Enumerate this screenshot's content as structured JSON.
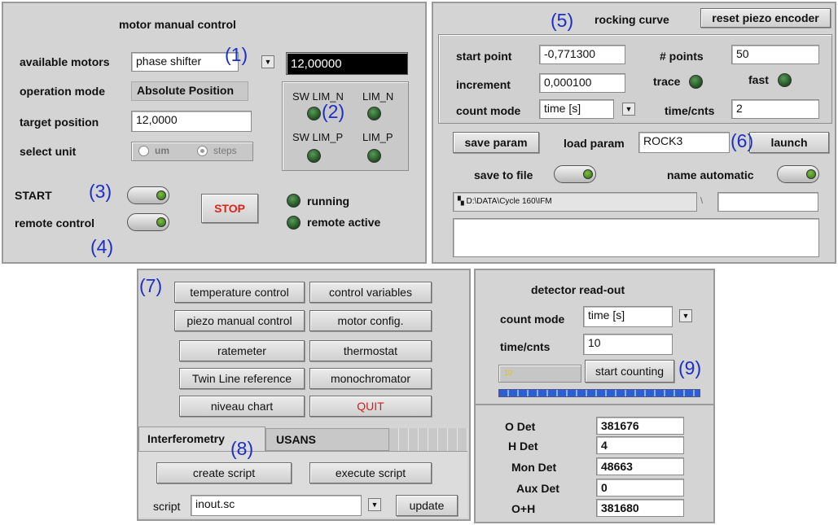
{
  "motor": {
    "title": "motor manual control",
    "available_motors_label": "available motors",
    "available_motors_value": "phase shifter",
    "operation_mode_label": "operation mode",
    "operation_mode_value": "Absolute Position",
    "target_position_label": "target position",
    "target_position_value": "12,0000",
    "select_unit_label": "select unit",
    "unit_um": "um",
    "unit_steps": "steps",
    "display_value": "12,00000",
    "sw_lim_n": "SW LIM_N",
    "lim_n": "LIM_N",
    "sw_lim_p": "SW LIM_P",
    "lim_p": "LIM_P",
    "start_label": "START",
    "remote_label": "remote control",
    "stop_label": "STOP",
    "running_label": "running",
    "remote_active_label": "remote active"
  },
  "rocking": {
    "title": "rocking curve",
    "reset_label": "reset piezo encoder",
    "start_point_label": "start point",
    "start_point_value": "-0,771300",
    "points_label": "# points",
    "points_value": "50",
    "increment_label": "increment",
    "increment_value": "0,000100",
    "trace_label": "trace",
    "fast_label": "fast",
    "count_mode_label": "count mode",
    "count_mode_value": "time [s]",
    "time_cnts_label": "time/cnts",
    "time_cnts_value": "2",
    "save_param_label": "save param",
    "load_param_label": "load param",
    "load_param_value": "ROCK3",
    "launch_label": "launch",
    "save_to_file_label": "save to file",
    "name_automatic_label": "name automatic",
    "path_value": "D:\\DATA\\Cycle 160\\IFM",
    "path_sep": "\\"
  },
  "tools": {
    "buttons": [
      "temperature control",
      "control variables",
      "piezo manual control",
      "motor config.",
      "ratemeter",
      "thermostat",
      "Twin Line reference",
      "monochromator",
      "niveau chart",
      "QUIT"
    ],
    "tabs": [
      "Interferometry",
      "USANS"
    ],
    "create_script_label": "create script",
    "execute_script_label": "execute script",
    "script_label": "script",
    "script_value": "inout.sc",
    "update_label": "update"
  },
  "detector": {
    "title": "detector read-out",
    "count_mode_label": "count mode",
    "count_mode_value": "time [s]",
    "time_cnts_label": "time/cnts",
    "time_cnts_value": "10",
    "start_counting_label": "start counting",
    "progress_value": "10",
    "rows": [
      {
        "label": "O Det",
        "value": "381676"
      },
      {
        "label": "H Det",
        "value": "4"
      },
      {
        "label": "Mon Det",
        "value": "48663"
      },
      {
        "label": "Aux Det",
        "value": "0"
      },
      {
        "label": "O+H",
        "value": "381680"
      }
    ]
  },
  "annotations": [
    "(1)",
    "(2)",
    "(3)",
    "(4)",
    "(5)",
    "(6)",
    "(7)",
    "(8)",
    "(9)"
  ],
  "colors": {
    "panel": "#d4d4d4",
    "led_green": "#2f6f2f",
    "quit_red": "#d0201a",
    "stop_red": "#d9261c",
    "annotation_blue": "#1c2ec9",
    "progress_blue": "#2c5fd6"
  }
}
